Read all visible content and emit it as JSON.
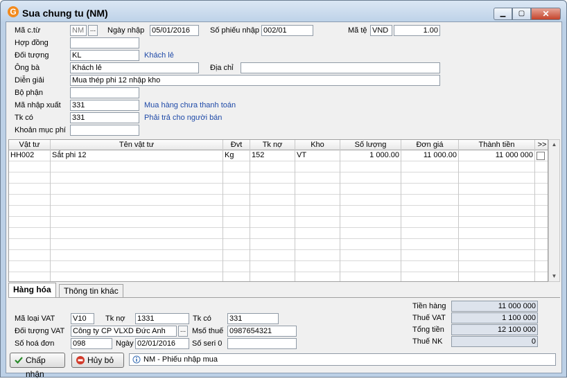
{
  "window": {
    "title": "Sua chung tu (NM)",
    "icon_glyph": "G"
  },
  "form": {
    "ma_ct": {
      "label": "Mã c.từ",
      "value": "NM",
      "btn": "..."
    },
    "ngay_nhap": {
      "label": "Ngày nhập",
      "value": "05/01/2016"
    },
    "so_phieu": {
      "label": "Số phiếu nhập",
      "value": "002/01"
    },
    "ma_te": {
      "label": "Mã tệ",
      "value": "VND",
      "rate": "1.00"
    },
    "hop_dong": {
      "label": "Hợp đồng",
      "value": ""
    },
    "doi_tuong": {
      "label": "Đối tượng",
      "value": "KL",
      "desc": "Khách lẻ"
    },
    "ong_ba": {
      "label": "Ông bà",
      "value": "Khách lẻ"
    },
    "dia_chi": {
      "label": "Địa chỉ",
      "value": ""
    },
    "dien_giai": {
      "label": "Diễn giải",
      "value": "Mua thép phi 12 nhập kho"
    },
    "bo_phan": {
      "label": "Bộ phận",
      "value": ""
    },
    "ma_nhap_xuat": {
      "label": "Mã nhập xuất",
      "value": "331",
      "desc": "Mua hàng chưa thanh toán"
    },
    "tk_co": {
      "label": "Tk có",
      "value": "331",
      "desc": "Phải trả cho người bán"
    },
    "khoan_muc_phi": {
      "label": "Khoản mục phí",
      "value": ""
    }
  },
  "grid": {
    "columns": [
      "Vật tư",
      "Tên vật tư",
      "Đvt",
      "Tk nợ",
      "Kho",
      "Số lượng",
      "Đơn giá",
      "Thành tiền",
      ">>"
    ],
    "rows": [
      [
        "HH002",
        "Sắt phi 12",
        "Kg",
        "152",
        "VT",
        "1 000.00",
        "11 000.00",
        "11 000 000"
      ]
    ],
    "scroll_up": "▲",
    "scroll_down": "▼"
  },
  "tabs": [
    {
      "label": "Hàng hóa",
      "active": true
    },
    {
      "label": "Thông tin khác",
      "active": false
    }
  ],
  "vat": {
    "ma_loai": {
      "label": "Mã loại VAT",
      "value": "V10"
    },
    "tk_no": {
      "label": "Tk nợ",
      "value": "1331"
    },
    "tk_co": {
      "label": "Tk có",
      "value": "331"
    },
    "doi_tuong": {
      "label": "Đối tượng VAT",
      "value": "Công ty CP VLXD Đức Anh",
      "btn": "..."
    },
    "ms_thue": {
      "label": "Msố thuế",
      "value": "0987654321"
    },
    "so_hoa_don": {
      "label": "Số hoá đơn",
      "value": "098"
    },
    "ngay": {
      "label": "Ngày",
      "value": "02/01/2016"
    },
    "so_seri": {
      "label": "Số seri 0",
      "value": ""
    }
  },
  "totals": {
    "tien_hang": {
      "label": "Tiền hàng",
      "value": "11 000 000"
    },
    "thue_vat": {
      "label": "Thuế VAT",
      "value": "1 100 000"
    },
    "tong_tien": {
      "label": "Tổng tiền",
      "value": "12 100 000"
    },
    "thue_nk": {
      "label": "Thuế NK",
      "value": "0"
    }
  },
  "buttons": {
    "accept": "Chấp nhận",
    "cancel": "Hủy bỏ"
  },
  "status_text": "NM - Phiếu nhập mua",
  "colors": {
    "accent_blue": "#1f4aa8",
    "readonly_bg": "#dde3ec",
    "close_red": "#c4432a"
  }
}
